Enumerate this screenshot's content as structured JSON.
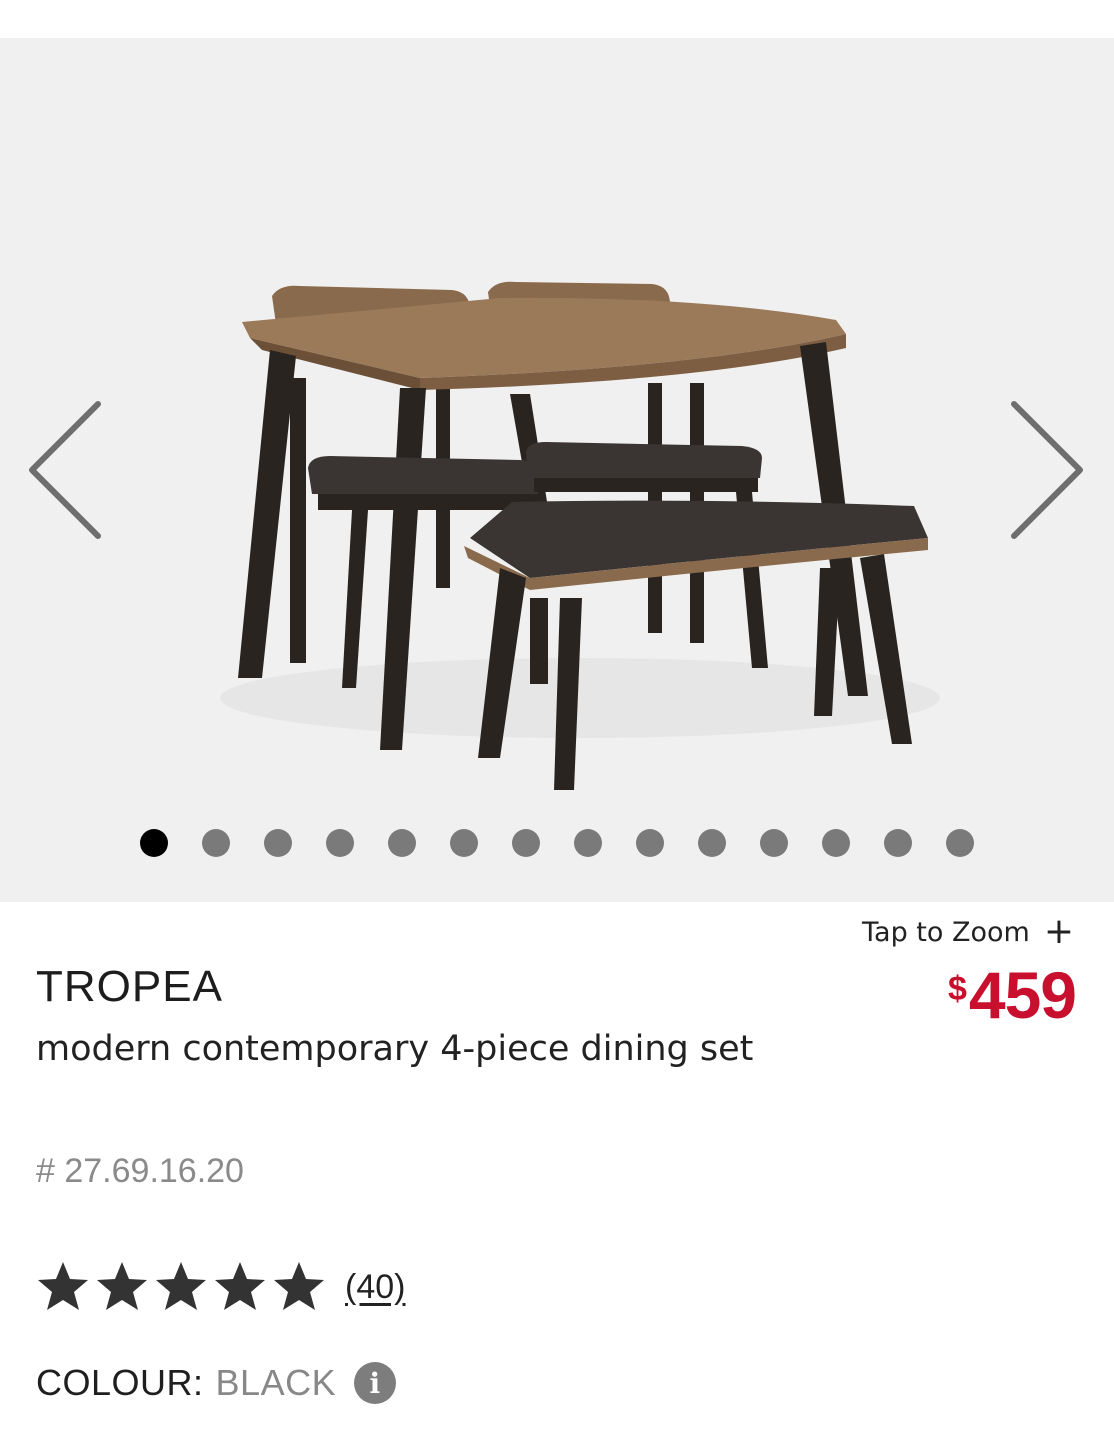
{
  "gallery": {
    "image_alt": "TROPEA modern contemporary 4-piece dining set",
    "prev_icon": "chevron-left-icon",
    "next_icon": "chevron-right-icon",
    "slide_count": 14,
    "active_slide": 1
  },
  "zoom": {
    "label": "Tap to Zoom",
    "icon": "plus-icon",
    "symbol": "+"
  },
  "price": {
    "currency": "$",
    "amount": "459",
    "color": "#c8102e"
  },
  "product": {
    "brand": "TROPEA",
    "title": "modern contemporary 4-piece dining set",
    "sku": "# 27.69.16.20"
  },
  "rating": {
    "stars": 5,
    "max": 5,
    "count": "(40)"
  },
  "colour": {
    "label": "COLOUR:",
    "value": "BLACK",
    "info_icon": "info-icon",
    "info_symbol": "i"
  }
}
